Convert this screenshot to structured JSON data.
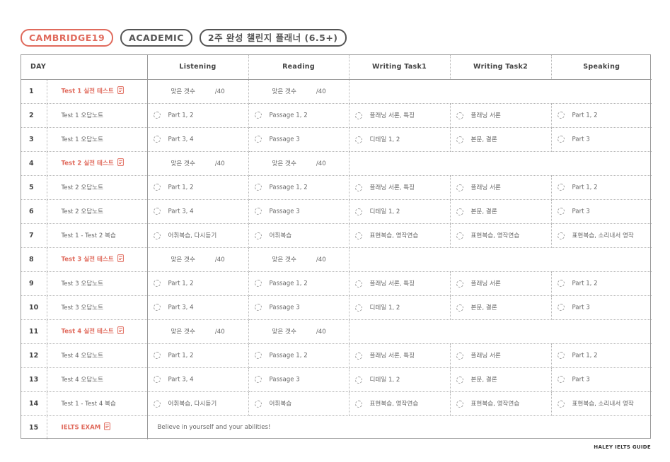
{
  "badges": [
    "CAMBRIDGE19",
    "ACADEMIC",
    "2주 완성 챌린지 플래너 (6.5+)"
  ],
  "headers": {
    "day": "DAY",
    "listening": "Listening",
    "reading": "Reading",
    "writing1": "Writing Task1",
    "writing2": "Writing Task2",
    "speaking": "Speaking"
  },
  "score_label": "맞은 갯수",
  "score_total": "/40",
  "rows": [
    {
      "day": "1",
      "task": "Test 1 실전 테스트"
    },
    {
      "day": "2",
      "task": "Test 1 오답노트",
      "listening": "Part 1, 2",
      "reading": "Passage 1, 2",
      "writing1": "플래닝 서론, 특징",
      "writing2": "플래닝 서론",
      "speaking": "Part 1, 2"
    },
    {
      "day": "3",
      "task": "Test 1 오답노트",
      "listening": "Part 3, 4",
      "reading": "Passage 3",
      "writing1": "디테일 1, 2",
      "writing2": "본문, 결론",
      "speaking": "Part 3"
    },
    {
      "day": "4",
      "task": "Test 2 실전 테스트"
    },
    {
      "day": "5",
      "task": "Test 2 오답노트",
      "listening": "Part 1, 2",
      "reading": "Passage 1, 2",
      "writing1": "플래닝 서론, 특징",
      "writing2": "플래닝 서론",
      "speaking": "Part 1, 2"
    },
    {
      "day": "6",
      "task": "Test 2 오답노트",
      "listening": "Part 3, 4",
      "reading": "Passage 3",
      "writing1": "디테일 1, 2",
      "writing2": "본문, 결론",
      "speaking": "Part 3"
    },
    {
      "day": "7",
      "task": "Test 1 - Test 2 복습",
      "listening": "어휘복습, 다시듣기",
      "reading": "어휘복습",
      "writing1": "표현복습, 영작연습",
      "writing2": "표현복습, 영작연습",
      "speaking": "표현복습, 소리내서 영작"
    },
    {
      "day": "8",
      "task": "Test 3 실전 테스트"
    },
    {
      "day": "9",
      "task": "Test 3 오답노트",
      "listening": "Part 1, 2",
      "reading": "Passage 1, 2",
      "writing1": "플래닝 서론, 특징",
      "writing2": "플래닝 서론",
      "speaking": "Part 1, 2"
    },
    {
      "day": "10",
      "task": "Test 3 오답노트",
      "listening": "Part 3, 4",
      "reading": "Passage 3",
      "writing1": "디테일 1, 2",
      "writing2": "본문, 결론",
      "speaking": "Part 3"
    },
    {
      "day": "11",
      "task": "Test 4 실전 테스트"
    },
    {
      "day": "12",
      "task": "Test 4 오답노트",
      "listening": "Part 1, 2",
      "reading": "Passage 1, 2",
      "writing1": "플래닝 서론, 특징",
      "writing2": "플래닝 서론",
      "speaking": "Part 1, 2"
    },
    {
      "day": "13",
      "task": "Test 4 오답노트",
      "listening": "Part 3, 4",
      "reading": "Passage 3",
      "writing1": "디테일 1, 2",
      "writing2": "본문, 결론",
      "speaking": "Part 3"
    },
    {
      "day": "14",
      "task": "Test 1 - Test 4 복습",
      "listening": "어휘복습, 다시듣기",
      "reading": "어휘복습",
      "writing1": "표현복습, 영작연습",
      "writing2": "표현복습, 영작연습",
      "speaking": "표현복습, 소리내서 영작"
    },
    {
      "day": "15",
      "task": "IELTS EXAM",
      "message": "Believe in yourself and your abilities!"
    }
  ],
  "footer": "HALEY IELTS GUIDE",
  "colors": {
    "accent": "#e06a5c",
    "text": "#555555",
    "border": "#9a9a9a"
  }
}
